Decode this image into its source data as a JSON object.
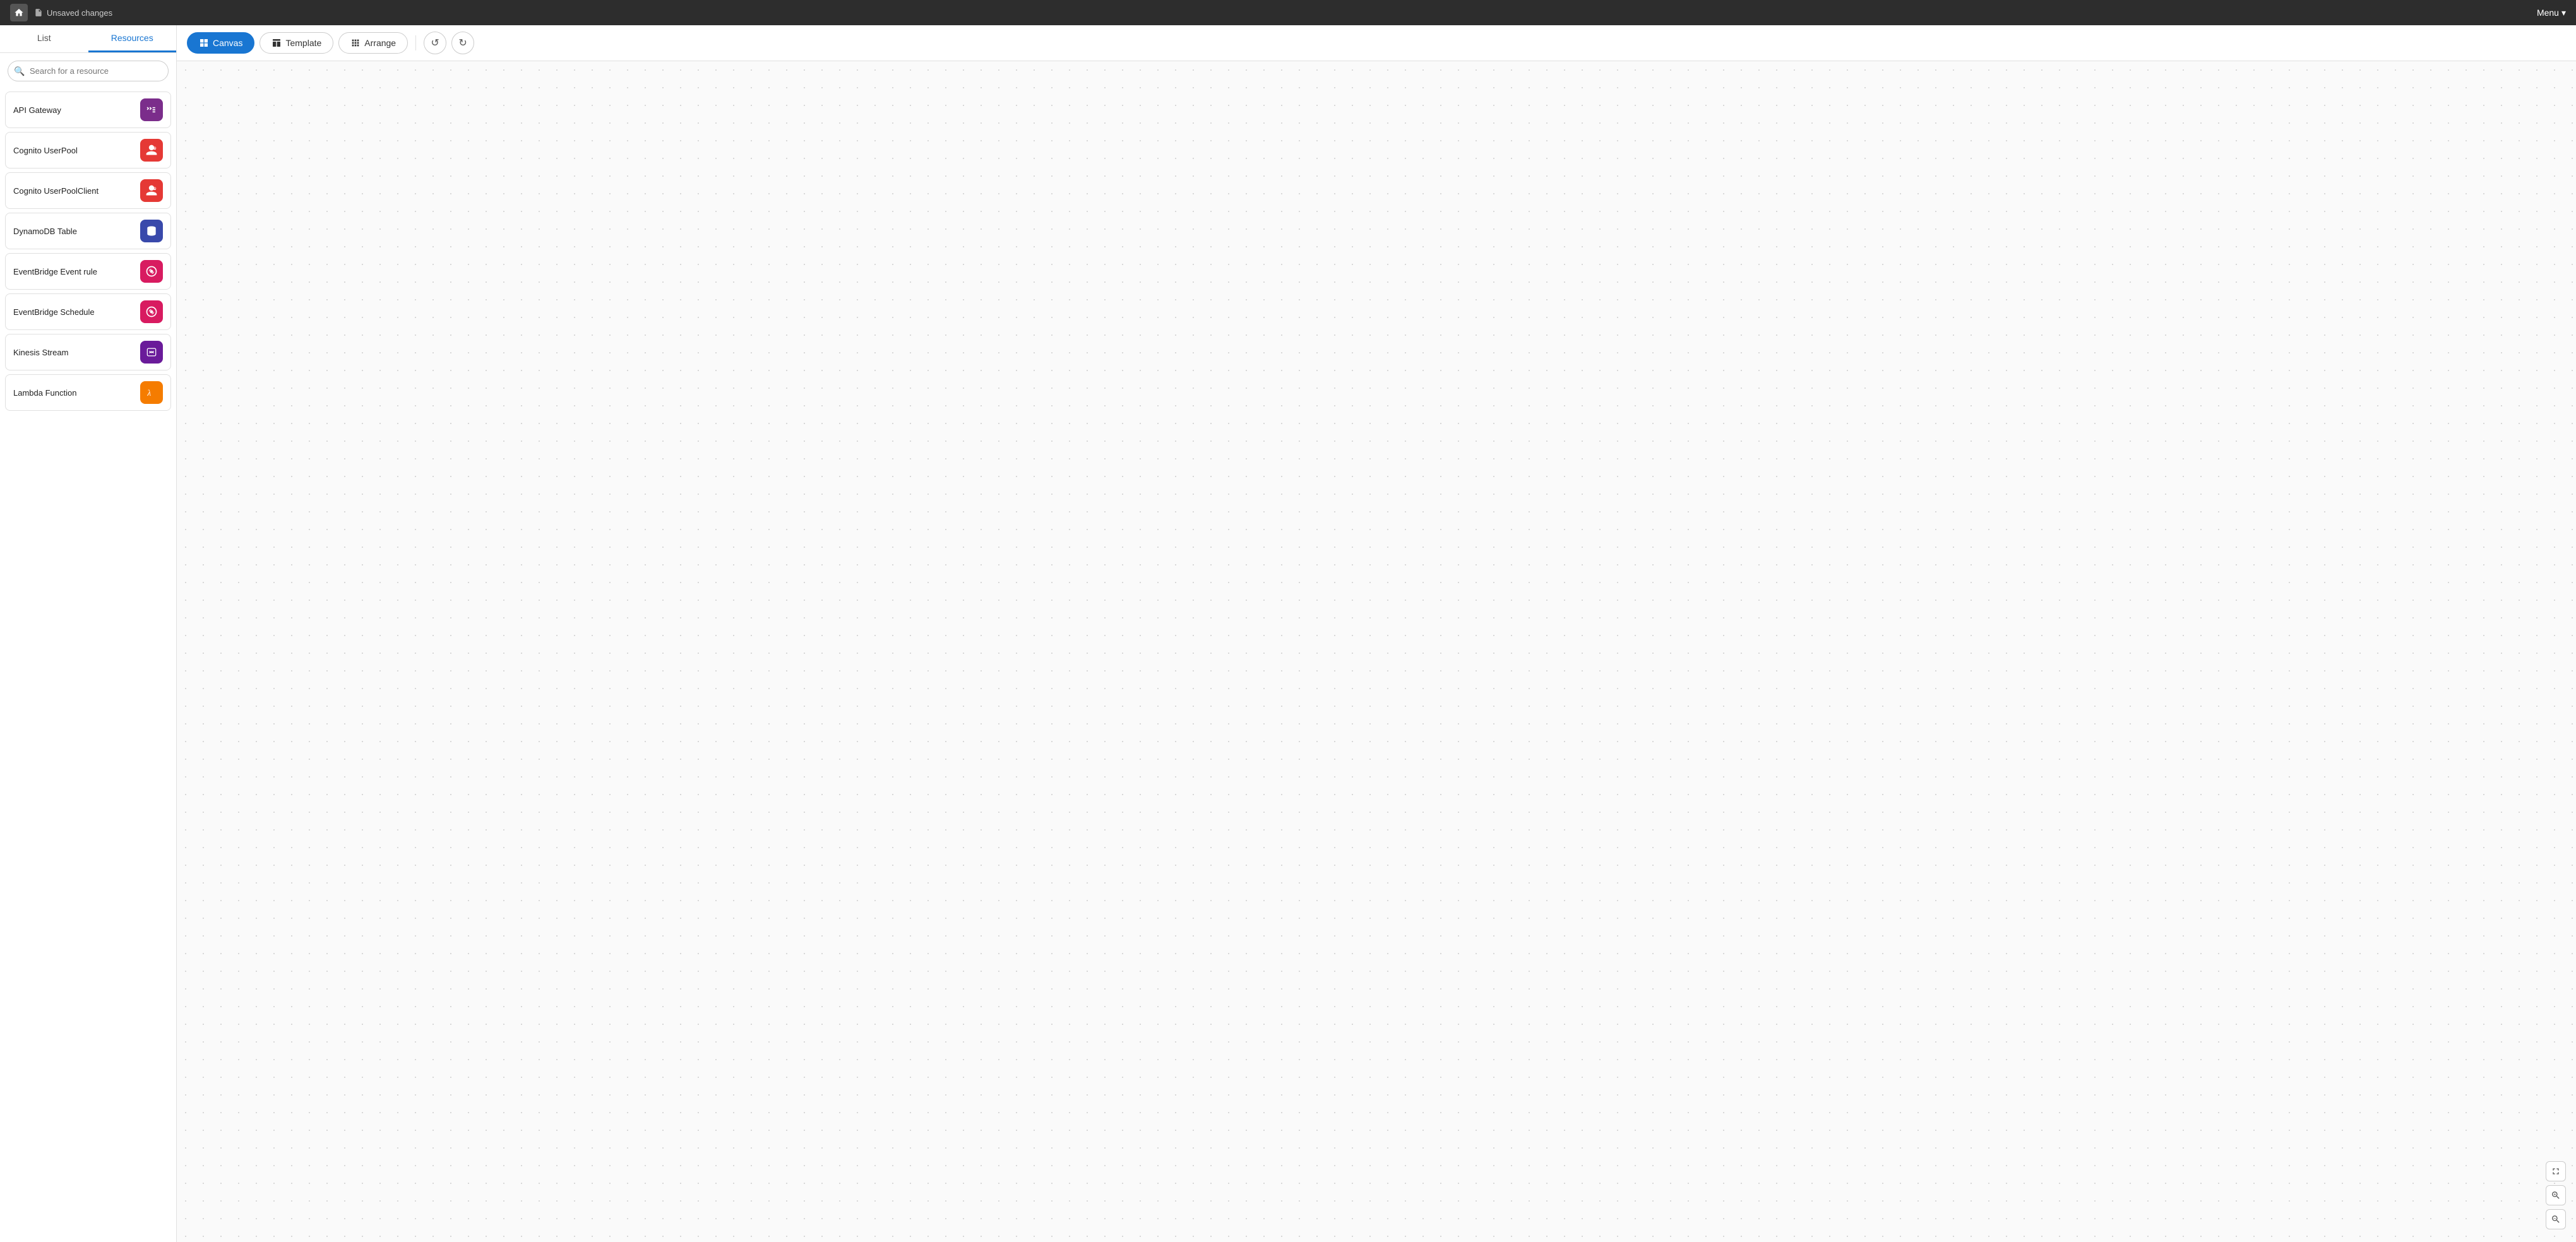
{
  "topbar": {
    "unsaved_label": "Unsaved changes",
    "menu_label": "Menu"
  },
  "sidebar": {
    "tab_list": "List",
    "tab_resources": "Resources",
    "search_placeholder": "Search for a resource",
    "resources": [
      {
        "name": "API Gateway",
        "bg": "#7b2d8b",
        "icon": "⊞",
        "emoji": "🔲"
      },
      {
        "name": "Cognito UserPool",
        "bg": "#e53935",
        "icon": "👤",
        "emoji": "🔲"
      },
      {
        "name": "Cognito UserPoolClient",
        "bg": "#e53935",
        "icon": "👤",
        "emoji": "🔲"
      },
      {
        "name": "DynamoDB Table",
        "bg": "#3949ab",
        "icon": "🗄",
        "emoji": "🔲"
      },
      {
        "name": "EventBridge Event rule",
        "bg": "#d81b60",
        "icon": "⚙",
        "emoji": "🔲"
      },
      {
        "name": "EventBridge Schedule",
        "bg": "#d81b60",
        "icon": "⚙",
        "emoji": "🔲"
      },
      {
        "name": "Kinesis Stream",
        "bg": "#6a1b9a",
        "icon": "〜",
        "emoji": "🔲"
      },
      {
        "name": "Lambda Function",
        "bg": "#f57c00",
        "icon": "λ",
        "emoji": "🔲"
      }
    ]
  },
  "toolbar": {
    "canvas_label": "Canvas",
    "template_label": "Template",
    "arrange_label": "Arrange"
  },
  "canvas": {},
  "zoom": {
    "zoom_in_label": "+",
    "zoom_out_label": "−"
  }
}
